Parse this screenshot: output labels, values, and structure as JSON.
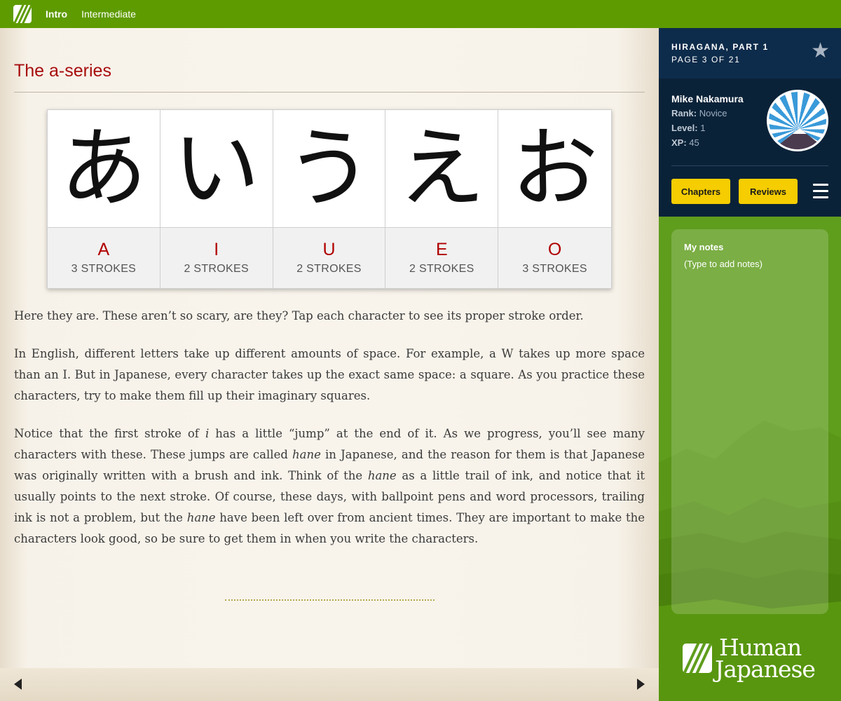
{
  "nav": {
    "items": [
      {
        "label": "Intro"
      },
      {
        "label": "Intermediate"
      }
    ]
  },
  "colors": {
    "topbar": "#5e9b00",
    "accent_red": "#a70d0d",
    "sidebar_navy": "#0d2c4b",
    "button_yellow": "#f5cd00",
    "sidebar_green": "#5f9d1d"
  },
  "lesson": {
    "title": "The a-series",
    "kana": [
      {
        "glyph": "あ",
        "romaji": "A",
        "strokes": "3 STROKES"
      },
      {
        "glyph": "い",
        "romaji": "I",
        "strokes": "2 STROKES"
      },
      {
        "glyph": "う",
        "romaji": "U",
        "strokes": "2 STROKES"
      },
      {
        "glyph": "え",
        "romaji": "E",
        "strokes": "2 STROKES"
      },
      {
        "glyph": "お",
        "romaji": "O",
        "strokes": "3 STROKES"
      }
    ],
    "p1": "Here they are. These aren’t so scary, are they? Tap each character to see its proper stroke order.",
    "p2": "In English, different letters take up different amounts of space. For example, a W takes up more space than an I. But in Japanese, every character takes up the exact same space: a square. As you practice these characters, try to make them fill up their imaginary squares.",
    "p3": {
      "s1": "Notice that the first stroke of ",
      "e1": "i",
      "s2": " has a little “jump” at the end of it. As we progress, you’ll see many characters with these. These jumps are called ",
      "e2": "hane",
      "s3": " in Japanese, and the reason for them is that Japanese was originally written with a brush and ink. Think of the ",
      "e3": "hane",
      "s4": " as a little trail of ink, and notice that it usually points to the next stroke. Of course, these days, with ballpoint pens and word processors, trailing ink is not a problem, but the ",
      "e4": "hane",
      "s5": " have been left over from ancient times. They are important to make the characters look good, so be sure to get them in when you write the characters."
    }
  },
  "sidebar": {
    "chapter": "HIRAGANA, PART 1",
    "page": "PAGE 3 OF 21",
    "star_icon": "star-icon",
    "user": {
      "name": "Mike Nakamura",
      "rank_label": "Rank:",
      "rank": "Novice",
      "level_label": "Level:",
      "level": "1",
      "xp_label": "XP:",
      "xp": "45"
    },
    "buttons": {
      "chapters": "Chapters",
      "reviews": "Reviews"
    },
    "notes": {
      "title": "My notes",
      "placeholder": "(Type to add notes)"
    },
    "brand": {
      "line1": "Human",
      "line2": "Japanese"
    }
  }
}
